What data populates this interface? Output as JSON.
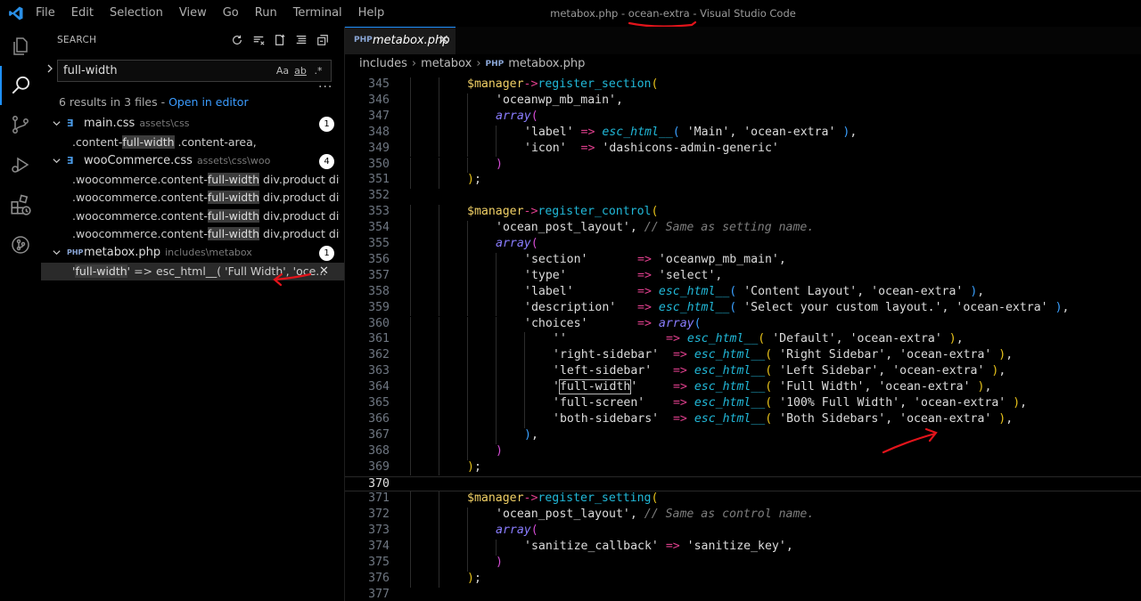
{
  "window": {
    "menu": [
      "File",
      "Edit",
      "Selection",
      "View",
      "Go",
      "Run",
      "Terminal",
      "Help"
    ],
    "title": "metabox.php - ocean-extra - Visual Studio Code"
  },
  "activity_bar": {
    "items": [
      "explorer-icon",
      "search-icon",
      "source-control-icon",
      "run-debug-icon",
      "extensions-icon",
      "git-history-icon"
    ],
    "active": "search-icon",
    "accent_color": "#1e90ff"
  },
  "sidebar": {
    "title": "SEARCH",
    "search": {
      "value": "full-width",
      "options": [
        "Aa",
        "ab",
        ".*"
      ]
    },
    "summary_text": "6 results in 3 files - ",
    "open_in_editor": "Open in editor",
    "results": [
      {
        "name": "main.css",
        "path": "assets\\css",
        "icon": "css-file-icon",
        "count": "1",
        "matches": [
          {
            "before": ".content-",
            "match": "full-width",
            "after": " .content-area,"
          }
        ]
      },
      {
        "name": "wooCommerce.css",
        "path": "assets\\css\\woo",
        "icon": "css-file-icon",
        "count": "4",
        "matches": [
          {
            "before": ".woocommerce.content-",
            "match": "full-width",
            "after": " div.product div.ima..."
          },
          {
            "before": ".woocommerce.content-",
            "match": "full-width",
            "after": " div.product div.sum..."
          },
          {
            "before": ".woocommerce.content-",
            "match": "full-width",
            "after": " div.product div.ima..."
          },
          {
            "before": ".woocommerce.content-",
            "match": "full-width",
            "after": " div.product div.sum..."
          }
        ]
      },
      {
        "name": "metabox.php",
        "path": "includes\\metabox",
        "icon": "php-file-icon",
        "count": "1",
        "matches": [
          {
            "before": "'",
            "match": "full-width",
            "after": "'        => esc_html__( 'Full Width', 'oce...",
            "selected": true
          }
        ]
      }
    ]
  },
  "editor": {
    "tab": {
      "label": "metabox.php",
      "icon_text": "PHP"
    },
    "breadcrumb": [
      "includes",
      "metabox",
      "metabox.php"
    ],
    "current_line": 370,
    "lines": [
      {
        "n": "345",
        "indent": 2,
        "code": [
          [
            "t-var",
            "$manager"
          ],
          [
            "t-op",
            "->"
          ],
          [
            "t-fn",
            "register_section"
          ],
          [
            "t-p1",
            "("
          ]
        ]
      },
      {
        "n": "346",
        "indent": 3,
        "code": [
          [
            "t-str",
            "'oceanwp_mb_main'"
          ],
          [
            "t-pl",
            ","
          ]
        ]
      },
      {
        "n": "347",
        "indent": 3,
        "code": [
          [
            "t-kw",
            "array"
          ],
          [
            "t-p2",
            "("
          ]
        ]
      },
      {
        "n": "348",
        "indent": 4,
        "code": [
          [
            "t-str",
            "'label'"
          ],
          [
            "t-pl",
            " "
          ],
          [
            "t-op",
            "=>"
          ],
          [
            "t-pl",
            " "
          ],
          [
            "t-fni",
            "esc_html__"
          ],
          [
            "t-p3",
            "("
          ],
          [
            "t-pl",
            " "
          ],
          [
            "t-str",
            "'Main'"
          ],
          [
            "t-pl",
            ", "
          ],
          [
            "t-str",
            "'ocean-extra'"
          ],
          [
            "t-pl",
            " "
          ],
          [
            "t-p3",
            ")"
          ],
          [
            "t-pl",
            ","
          ]
        ]
      },
      {
        "n": "349",
        "indent": 4,
        "code": [
          [
            "t-str",
            "'icon'"
          ],
          [
            "t-pl",
            "  "
          ],
          [
            "t-op",
            "=>"
          ],
          [
            "t-pl",
            " "
          ],
          [
            "t-str",
            "'dashicons-admin-generic'"
          ]
        ]
      },
      {
        "n": "350",
        "indent": 3,
        "code": [
          [
            "t-p2",
            ")"
          ]
        ]
      },
      {
        "n": "351",
        "indent": 2,
        "code": [
          [
            "t-p1",
            ")"
          ],
          [
            "t-pl",
            ";"
          ]
        ]
      },
      {
        "n": "352",
        "indent": 0,
        "code": []
      },
      {
        "n": "353",
        "indent": 2,
        "code": [
          [
            "t-var",
            "$manager"
          ],
          [
            "t-op",
            "->"
          ],
          [
            "t-fn",
            "register_control"
          ],
          [
            "t-p1",
            "("
          ]
        ]
      },
      {
        "n": "354",
        "indent": 3,
        "code": [
          [
            "t-str",
            "'ocean_post_layout'"
          ],
          [
            "t-pl",
            ", "
          ],
          [
            "t-cm",
            "// Same as setting name."
          ]
        ]
      },
      {
        "n": "355",
        "indent": 3,
        "code": [
          [
            "t-kw",
            "array"
          ],
          [
            "t-p2",
            "("
          ]
        ]
      },
      {
        "n": "356",
        "indent": 4,
        "code": [
          [
            "t-str",
            "'section'"
          ],
          [
            "t-pl",
            "       "
          ],
          [
            "t-op",
            "=>"
          ],
          [
            "t-pl",
            " "
          ],
          [
            "t-str",
            "'oceanwp_mb_main'"
          ],
          [
            "t-pl",
            ","
          ]
        ]
      },
      {
        "n": "357",
        "indent": 4,
        "code": [
          [
            "t-str",
            "'type'"
          ],
          [
            "t-pl",
            "          "
          ],
          [
            "t-op",
            "=>"
          ],
          [
            "t-pl",
            " "
          ],
          [
            "t-str",
            "'select'"
          ],
          [
            "t-pl",
            ","
          ]
        ]
      },
      {
        "n": "358",
        "indent": 4,
        "code": [
          [
            "t-str",
            "'label'"
          ],
          [
            "t-pl",
            "         "
          ],
          [
            "t-op",
            "=>"
          ],
          [
            "t-pl",
            " "
          ],
          [
            "t-fni",
            "esc_html__"
          ],
          [
            "t-p3",
            "("
          ],
          [
            "t-pl",
            " "
          ],
          [
            "t-str",
            "'Content Layout'"
          ],
          [
            "t-pl",
            ", "
          ],
          [
            "t-str",
            "'ocean-extra'"
          ],
          [
            "t-pl",
            " "
          ],
          [
            "t-p3",
            ")"
          ],
          [
            "t-pl",
            ","
          ]
        ]
      },
      {
        "n": "359",
        "indent": 4,
        "code": [
          [
            "t-str",
            "'description'"
          ],
          [
            "t-pl",
            "   "
          ],
          [
            "t-op",
            "=>"
          ],
          [
            "t-pl",
            " "
          ],
          [
            "t-fni",
            "esc_html__"
          ],
          [
            "t-p3",
            "("
          ],
          [
            "t-pl",
            " "
          ],
          [
            "t-str",
            "'Select your custom layout.'"
          ],
          [
            "t-pl",
            ", "
          ],
          [
            "t-str",
            "'ocean-extra'"
          ],
          [
            "t-pl",
            " "
          ],
          [
            "t-p3",
            ")"
          ],
          [
            "t-pl",
            ","
          ]
        ]
      },
      {
        "n": "360",
        "indent": 4,
        "code": [
          [
            "t-str",
            "'choices'"
          ],
          [
            "t-pl",
            "       "
          ],
          [
            "t-op",
            "=>"
          ],
          [
            "t-pl",
            " "
          ],
          [
            "t-kw",
            "array"
          ],
          [
            "t-p3",
            "("
          ]
        ]
      },
      {
        "n": "361",
        "indent": 5,
        "code": [
          [
            "t-str",
            "''"
          ],
          [
            "t-pl",
            "              "
          ],
          [
            "t-op",
            "=>"
          ],
          [
            "t-pl",
            " "
          ],
          [
            "t-fni",
            "esc_html__"
          ],
          [
            "t-p1",
            "("
          ],
          [
            "t-pl",
            " "
          ],
          [
            "t-str",
            "'Default'"
          ],
          [
            "t-pl",
            ", "
          ],
          [
            "t-str",
            "'ocean-extra'"
          ],
          [
            "t-pl",
            " "
          ],
          [
            "t-p1",
            ")"
          ],
          [
            "t-pl",
            ","
          ]
        ]
      },
      {
        "n": "362",
        "indent": 5,
        "code": [
          [
            "t-str",
            "'right-sidebar'"
          ],
          [
            "t-pl",
            "  "
          ],
          [
            "t-op",
            "=>"
          ],
          [
            "t-pl",
            " "
          ],
          [
            "t-fni",
            "esc_html__"
          ],
          [
            "t-p1",
            "("
          ],
          [
            "t-pl",
            " "
          ],
          [
            "t-str",
            "'Right Sidebar'"
          ],
          [
            "t-pl",
            ", "
          ],
          [
            "t-str",
            "'ocean-extra'"
          ],
          [
            "t-pl",
            " "
          ],
          [
            "t-p1",
            ")"
          ],
          [
            "t-pl",
            ","
          ]
        ]
      },
      {
        "n": "363",
        "indent": 5,
        "code": [
          [
            "t-str",
            "'left-sidebar'"
          ],
          [
            "t-pl",
            "   "
          ],
          [
            "t-op",
            "=>"
          ],
          [
            "t-pl",
            " "
          ],
          [
            "t-fni",
            "esc_html__"
          ],
          [
            "t-p1",
            "("
          ],
          [
            "t-pl",
            " "
          ],
          [
            "t-str",
            "'Left Sidebar'"
          ],
          [
            "t-pl",
            ", "
          ],
          [
            "t-str",
            "'ocean-extra'"
          ],
          [
            "t-pl",
            " "
          ],
          [
            "t-p1",
            ")"
          ],
          [
            "t-pl",
            ","
          ]
        ]
      },
      {
        "n": "364",
        "indent": 5,
        "code": [
          [
            "t-str",
            "'"
          ],
          [
            "t-str boxed",
            "full-width"
          ],
          [
            "t-str",
            "'"
          ],
          [
            "t-pl",
            "     "
          ],
          [
            "t-op",
            "=>"
          ],
          [
            "t-pl",
            " "
          ],
          [
            "t-fni",
            "esc_html__"
          ],
          [
            "t-p1",
            "("
          ],
          [
            "t-pl",
            " "
          ],
          [
            "t-str",
            "'Full Width'"
          ],
          [
            "t-pl",
            ", "
          ],
          [
            "t-str",
            "'ocean-extra'"
          ],
          [
            "t-pl",
            " "
          ],
          [
            "t-p1",
            ")"
          ],
          [
            "t-pl",
            ","
          ]
        ]
      },
      {
        "n": "365",
        "indent": 5,
        "code": [
          [
            "t-str",
            "'full-screen'"
          ],
          [
            "t-pl",
            "    "
          ],
          [
            "t-op",
            "=>"
          ],
          [
            "t-pl",
            " "
          ],
          [
            "t-fni",
            "esc_html__"
          ],
          [
            "t-p1",
            "("
          ],
          [
            "t-pl",
            " "
          ],
          [
            "t-str",
            "'100% Full Width'"
          ],
          [
            "t-pl",
            ", "
          ],
          [
            "t-str",
            "'ocean-extra'"
          ],
          [
            "t-pl",
            " "
          ],
          [
            "t-p1",
            ")"
          ],
          [
            "t-pl",
            ","
          ]
        ]
      },
      {
        "n": "366",
        "indent": 5,
        "code": [
          [
            "t-str",
            "'both-sidebars'"
          ],
          [
            "t-pl",
            "  "
          ],
          [
            "t-op",
            "=>"
          ],
          [
            "t-pl",
            " "
          ],
          [
            "t-fni",
            "esc_html__"
          ],
          [
            "t-p1",
            "("
          ],
          [
            "t-pl",
            " "
          ],
          [
            "t-str",
            "'Both Sidebars'"
          ],
          [
            "t-pl",
            ", "
          ],
          [
            "t-str",
            "'ocean-extra'"
          ],
          [
            "t-pl",
            " "
          ],
          [
            "t-p1",
            ")"
          ],
          [
            "t-pl",
            ","
          ]
        ]
      },
      {
        "n": "367",
        "indent": 4,
        "code": [
          [
            "t-p3",
            ")"
          ],
          [
            "t-pl",
            ","
          ]
        ]
      },
      {
        "n": "368",
        "indent": 3,
        "code": [
          [
            "t-p2",
            ")"
          ]
        ]
      },
      {
        "n": "369",
        "indent": 2,
        "code": [
          [
            "t-p1",
            ")"
          ],
          [
            "t-pl",
            ";"
          ]
        ]
      },
      {
        "n": "370",
        "indent": 0,
        "code": []
      },
      {
        "n": "371",
        "indent": 2,
        "code": [
          [
            "t-var",
            "$manager"
          ],
          [
            "t-op",
            "->"
          ],
          [
            "t-fn",
            "register_setting"
          ],
          [
            "t-p1",
            "("
          ]
        ]
      },
      {
        "n": "372",
        "indent": 3,
        "code": [
          [
            "t-str",
            "'ocean_post_layout'"
          ],
          [
            "t-pl",
            ", "
          ],
          [
            "t-cm",
            "// Same as control name."
          ]
        ]
      },
      {
        "n": "373",
        "indent": 3,
        "code": [
          [
            "t-kw",
            "array"
          ],
          [
            "t-p2",
            "("
          ]
        ]
      },
      {
        "n": "374",
        "indent": 4,
        "code": [
          [
            "t-str",
            "'sanitize_callback'"
          ],
          [
            "t-pl",
            " "
          ],
          [
            "t-op",
            "=>"
          ],
          [
            "t-pl",
            " "
          ],
          [
            "t-str",
            "'sanitize_key'"
          ],
          [
            "t-pl",
            ","
          ]
        ]
      },
      {
        "n": "375",
        "indent": 3,
        "code": [
          [
            "t-p2",
            ")"
          ]
        ]
      },
      {
        "n": "376",
        "indent": 2,
        "code": [
          [
            "t-p1",
            ")"
          ],
          [
            "t-pl",
            ";"
          ]
        ]
      },
      {
        "n": "377",
        "indent": 0,
        "code": []
      }
    ]
  },
  "annotations": {
    "color": "#e3141b",
    "marks": [
      "title-underline",
      "sidebar-arrow",
      "code-arrow"
    ]
  }
}
